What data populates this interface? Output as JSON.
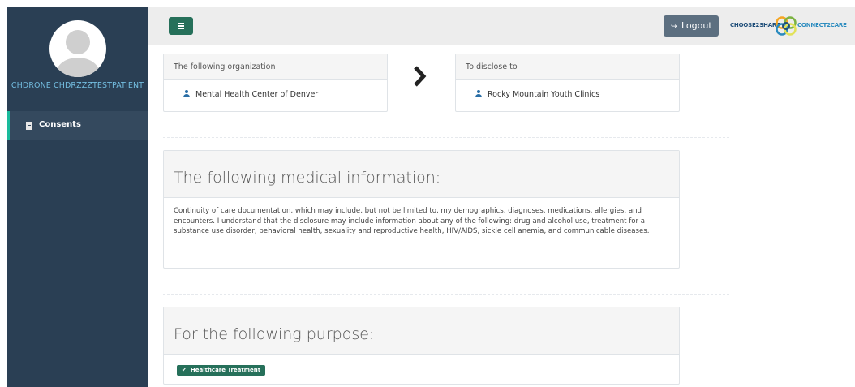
{
  "user": {
    "name": "CHDRONE CHDRZZZTESTPATIENT"
  },
  "sidebar": {
    "items": [
      {
        "label": "Consents",
        "icon": "file-icon"
      }
    ]
  },
  "topbar": {
    "logout_label": "Logout",
    "logout_icon": "sign-out-icon",
    "brand_left": "CHOOSE2SHARE",
    "brand_right": "CONNECT2CARE"
  },
  "consent": {
    "from_header": "The following organization",
    "from_org": "Mental Health Center of Denver",
    "to_header": "To disclose to",
    "to_org": "Rocky Mountain Youth Clinics",
    "medical_title": "The following medical information:",
    "medical_text": "Continuity of care documentation, which may include, but not be limited to, my demographics, diagnoses, medications, allergies, and encounters. I understand that the disclosure may include information about any of the following: drug and alcohol use, treatment for a substance use disorder, behavioral health, sexuality and reproductive health, HIV/AIDS, sickle cell anemia, and communicable diseases.",
    "purpose_title": "For the following purpose:",
    "purpose_badge": "Healthcare Treatment"
  },
  "colors": {
    "sidebar": "#2a3f54",
    "accent": "#26705a",
    "link": "#73bde0"
  }
}
